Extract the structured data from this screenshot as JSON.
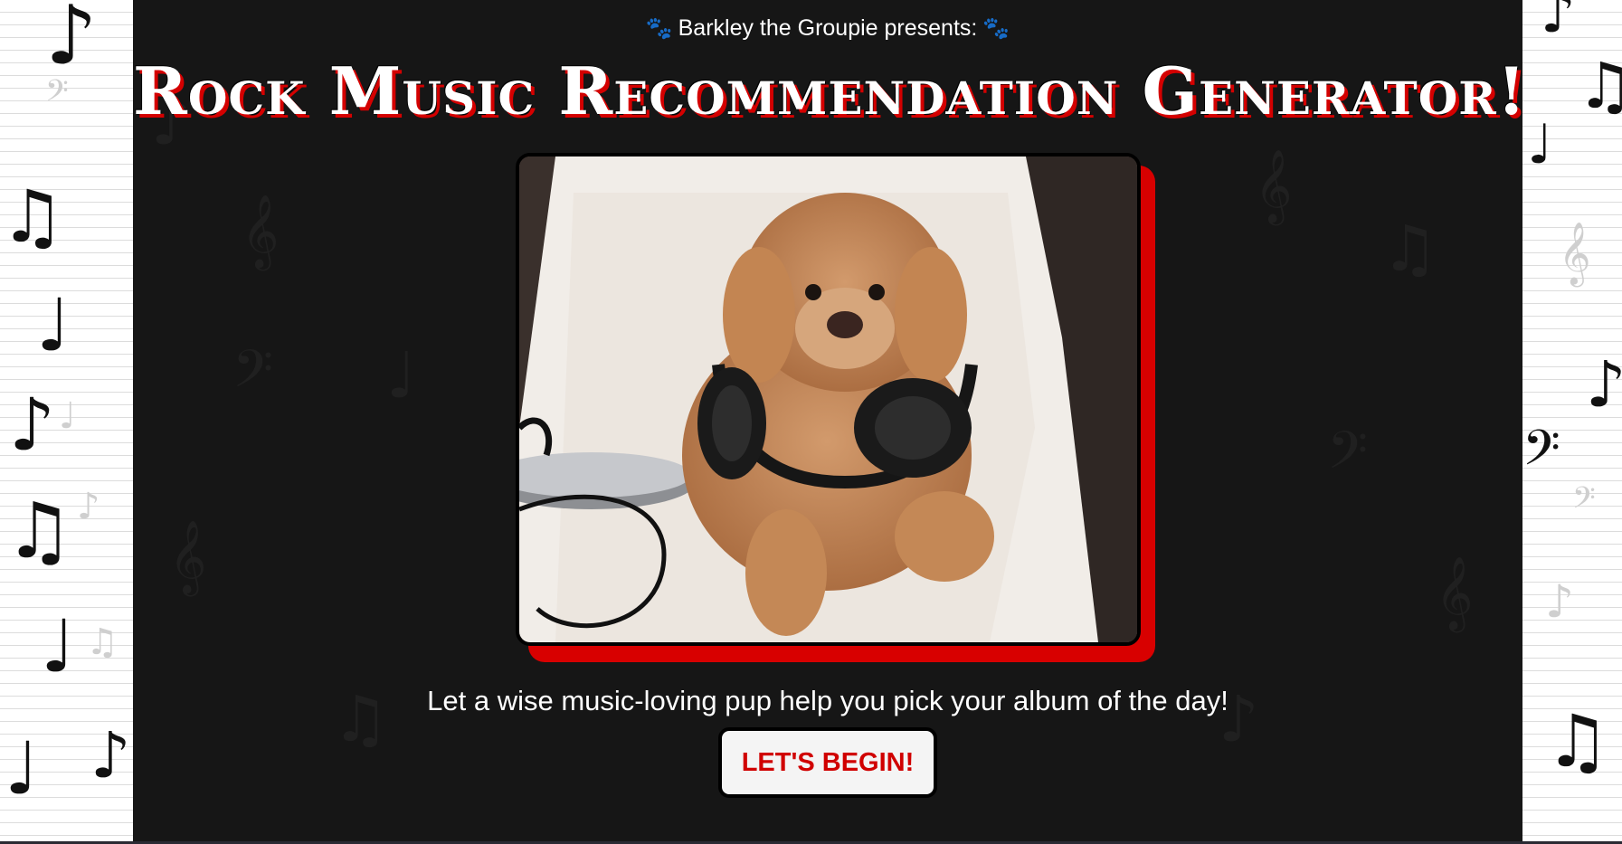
{
  "header": {
    "presents_text": "Barkley the Groupie presents:",
    "paw_icon": "paw-icon",
    "title": "Rock Music Recommendation Generator!"
  },
  "hero": {
    "image_description_icon": "poodle-with-headphones-photo"
  },
  "main": {
    "tagline": "Let a wise music-loving pup help you pick your album of the day!",
    "begin_button_label": "LET'S BEGIN!"
  },
  "colors": {
    "background": "#161616",
    "accent": "#d80000",
    "text": "#ffffff",
    "button_bg": "#f4f4f4"
  }
}
